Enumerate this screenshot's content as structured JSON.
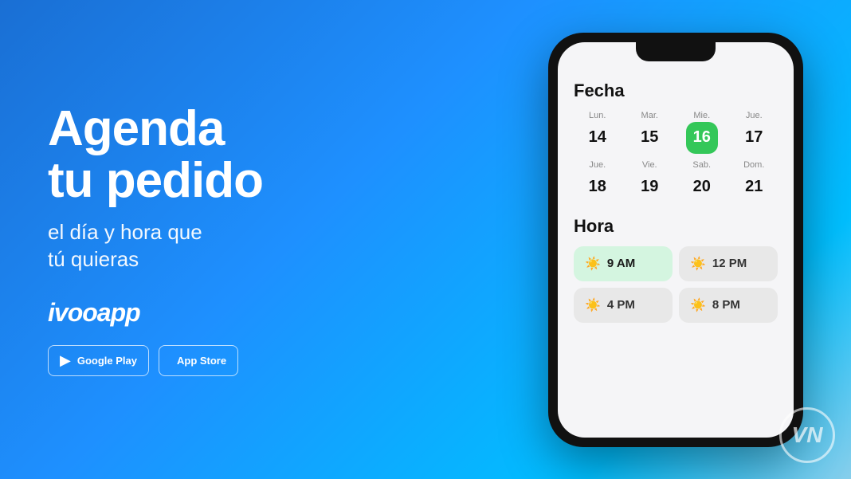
{
  "brand": {
    "name": "ivooapp",
    "logo_text": "ivooapp"
  },
  "headline": {
    "line1": "Agenda",
    "line2": "tu pedido",
    "subline1": "el día y hora que",
    "subline2": "tú quieras"
  },
  "store_buttons": [
    {
      "icon": "▶",
      "label": "Google Play"
    },
    {
      "icon": "",
      "label": "App Store"
    }
  ],
  "calendar": {
    "title": "Fecha",
    "row1": [
      {
        "day": "Lun.",
        "date": "14",
        "selected": false
      },
      {
        "day": "Mar.",
        "date": "15",
        "selected": false
      },
      {
        "day": "Mie.",
        "date": "16",
        "selected": true
      },
      {
        "day": "Jue.",
        "date": "17",
        "selected": false
      }
    ],
    "row2": [
      {
        "day": "Jue.",
        "date": "18",
        "selected": false
      },
      {
        "day": "Vie.",
        "date": "19",
        "selected": false
      },
      {
        "day": "Sab.",
        "date": "20",
        "selected": false
      },
      {
        "day": "Dom.",
        "date": "21",
        "selected": false
      }
    ]
  },
  "time": {
    "title": "Hora",
    "slots": [
      {
        "time": "9 AM",
        "active": true
      },
      {
        "time": "12 PM",
        "active": false
      },
      {
        "time": "4 PM",
        "active": false
      },
      {
        "time": "8 PM",
        "active": false
      }
    ]
  },
  "watermark": {
    "text": "VN"
  }
}
